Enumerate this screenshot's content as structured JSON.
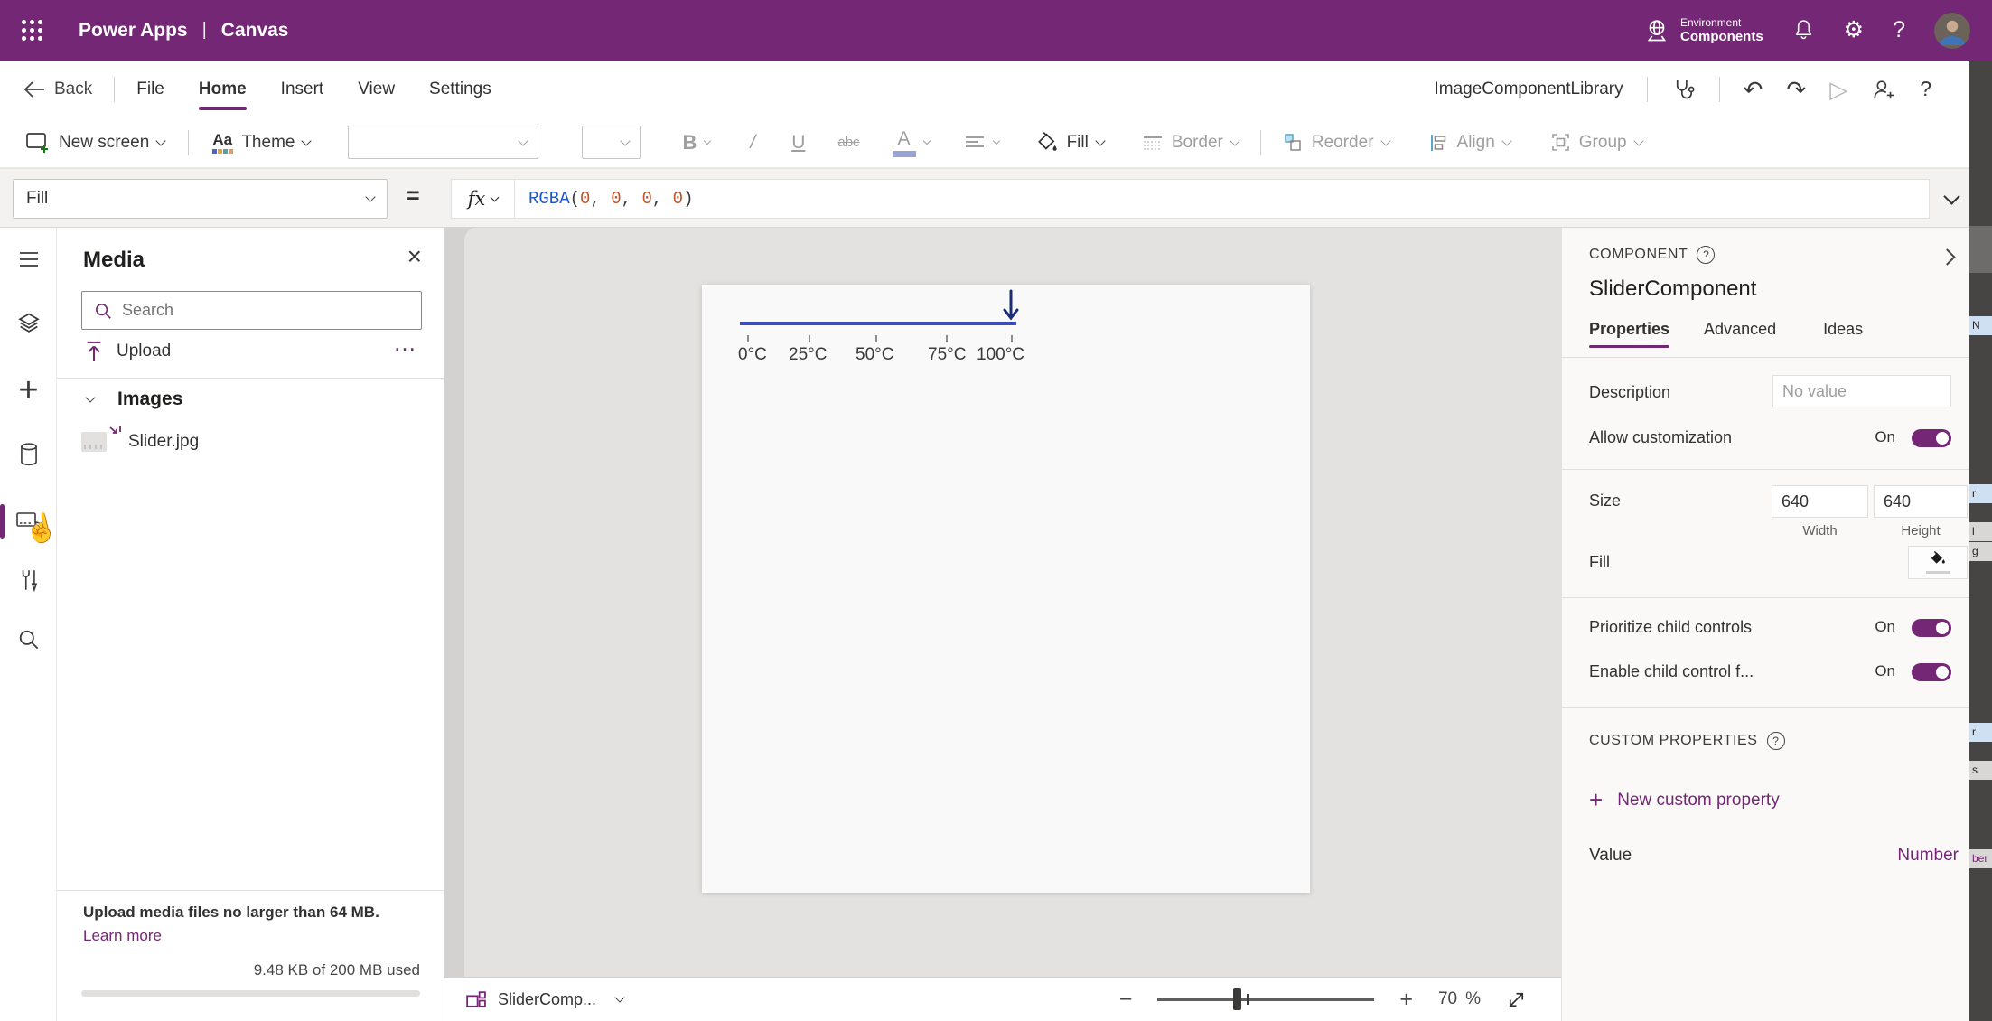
{
  "header": {
    "brand": "Power Apps",
    "separator": "|",
    "app": "Canvas",
    "environment_label": "Environment",
    "environment_name": "Components"
  },
  "menubar": {
    "back_label": "Back",
    "items": [
      "File",
      "Home",
      "Insert",
      "View",
      "Settings"
    ],
    "active_item": "Home",
    "library_name": "ImageComponentLibrary"
  },
  "ribbon": {
    "new_screen_label": "New screen",
    "theme_label": "Theme",
    "theme_glyph": "Aa",
    "bold_glyph": "B",
    "italic_glyph": "/",
    "underline_glyph": "U",
    "strikethrough_glyph": "abc",
    "font_color_glyph": "A",
    "fill_label": "Fill",
    "border_label": "Border",
    "reorder_label": "Reorder",
    "align_label": "Align",
    "group_label": "Group"
  },
  "formula_bar": {
    "property_selector": "Fill",
    "equals": "=",
    "fx_label": "fx",
    "formula_text": "RGBA(0, 0, 0, 0)",
    "tokens": [
      {
        "text": "RGBA",
        "type": "function"
      },
      {
        "text": "(",
        "type": "punct"
      },
      {
        "text": "0",
        "type": "number"
      },
      {
        "text": ", ",
        "type": "punct"
      },
      {
        "text": "0",
        "type": "number"
      },
      {
        "text": ", ",
        "type": "punct"
      },
      {
        "text": "0",
        "type": "number"
      },
      {
        "text": ", ",
        "type": "punct"
      },
      {
        "text": "0",
        "type": "number"
      },
      {
        "text": ")",
        "type": "punct"
      }
    ]
  },
  "media_panel": {
    "title": "Media",
    "search_placeholder": "Search",
    "upload_label": "Upload",
    "more_label": "…",
    "images_section": "Images",
    "items": [
      "Slider.jpg"
    ],
    "note": "Upload media files no larger than 64 MB.",
    "learn_more": "Learn more",
    "usage": "9.48 KB of 200 MB used"
  },
  "canvas": {
    "slider_labels": [
      "0°C",
      "25°C",
      "50°C",
      "75°C",
      "100°C"
    ]
  },
  "properties_panel": {
    "header": "COMPONENT",
    "component_name": "SliderComponent",
    "tabs": [
      "Properties",
      "Advanced",
      "Ideas"
    ],
    "active_tab": "Properties",
    "description_label": "Description",
    "description_placeholder": "No value",
    "allow_customization_label": "Allow customization",
    "toggle_on": "On",
    "size_label": "Size",
    "width_value": "640",
    "height_value": "640",
    "width_label": "Width",
    "height_label": "Height",
    "fill_label": "Fill",
    "prioritize_label": "Prioritize child controls",
    "enable_child_label": "Enable child control f...",
    "custom_properties_header": "CUSTOM PROPERTIES",
    "new_custom_property": "New custom property",
    "value_label": "Value",
    "value_type": "Number"
  },
  "bottom_bar": {
    "component_name": "SliderComp...",
    "minus": "−",
    "plus": "+",
    "zoom_value": "70",
    "percent": "%"
  },
  "edge_fragments": [
    "N",
    "r",
    "l",
    "g",
    "r",
    "s",
    "ber"
  ],
  "icons": {
    "gear": "⚙",
    "undo": "↶",
    "redo": "↷",
    "play": "▷",
    "close": "×",
    "plus": "+",
    "help": "?",
    "cursor": "☝"
  },
  "colors": {
    "brand_purple": "#742774",
    "formula_function_blue": "#1f56c4",
    "formula_number_orange": "#c0532a",
    "slider_track_blue": "#3b4cc0",
    "slider_pointer_navy": "#1c2c77"
  }
}
